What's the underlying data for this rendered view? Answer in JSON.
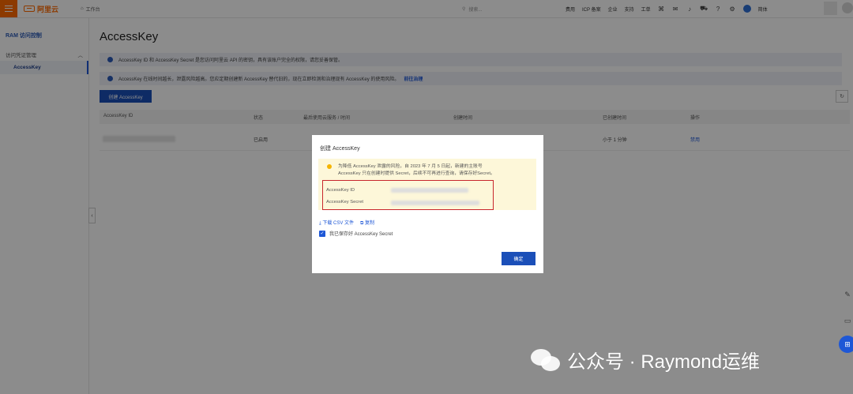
{
  "topbar": {
    "brand": "阿里云",
    "workbench": "工作台",
    "search_placeholder": "搜索...",
    "nav": [
      "费用",
      "ICP 备案",
      "企业",
      "支持",
      "工单"
    ],
    "lang": "简体"
  },
  "sidebar": {
    "title": "RAM 访问控制",
    "group": "访问凭证管理",
    "active_item": "AccessKey"
  },
  "main": {
    "title": "AccessKey",
    "notice1": "AccessKey ID 和 AccessKey Secret 是您访问阿里云 API 的密钥，具有该账户完全的权限，请您妥善保管。",
    "notice2": "AccessKey 在线时间越长，泄露风险越高。您应定期创建新 AccessKey 替代旧的，现在立即检测和治理现有 AccessKey 的使用风险。",
    "notice2_link": "前往治理",
    "create_button": "创建 AccessKey",
    "table": {
      "headers": [
        "AccessKey ID",
        "状态",
        "最后使用云服务 / 时间",
        "创建时间",
        "已创建时间",
        "操作"
      ],
      "row": {
        "status": "已启用",
        "age": "小于 1 分钟",
        "action": "禁用"
      }
    }
  },
  "dialog": {
    "title": "创建 AccessKey",
    "warning_line1": "为降低 AccessKey 泄露的风险，自 2023 年 7 月 5 日起，新建的主账号",
    "warning_line2": "AccessKey 只在创建时提供 Secret，后续不可再进行查询，请保存好Secret。",
    "id_label": "AccessKey ID",
    "secret_label": "AccessKey Secret",
    "download_link": "下载 CSV 文件",
    "copy_link": "复制",
    "checkbox_label": "我已保存好 AccessKey Secret",
    "confirm_button": "确定"
  },
  "watermark": "公众号 · Raymond运维"
}
